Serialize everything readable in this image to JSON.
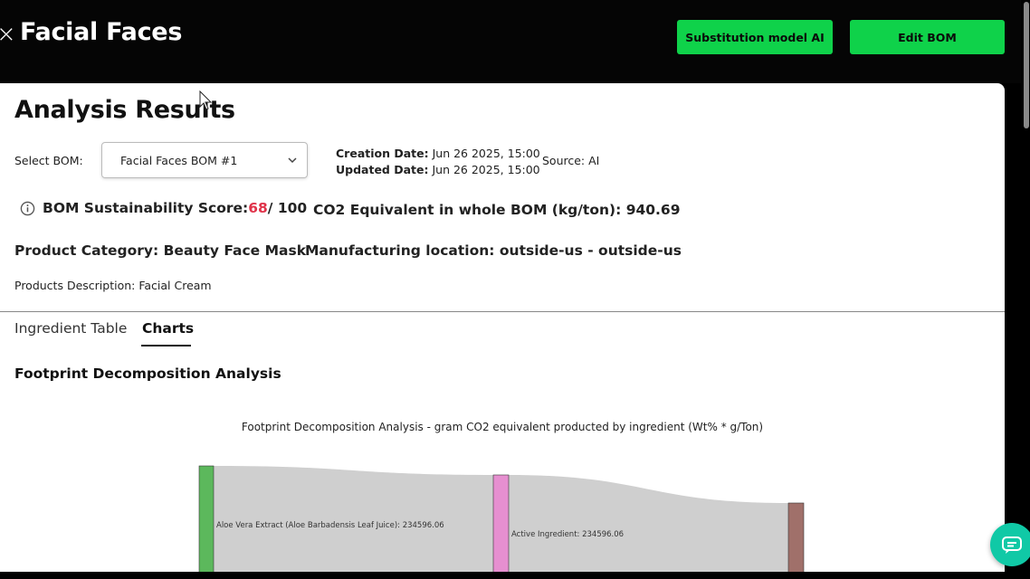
{
  "header": {
    "back_icon": "close-x-icon",
    "title": "Facial Faces",
    "buttons": {
      "substitution": "Substitution model AI",
      "edit_bom": "Edit BOM"
    },
    "accent_color": "#0fd24a"
  },
  "main": {
    "title": "Analysis Results",
    "select_label": "Select BOM:",
    "selected_bom": "Facial Faces BOM #1",
    "creation_label": "Creation Date:",
    "creation_value": " Jun 26 2025, 15:00",
    "updated_label": "Updated Date:",
    "updated_value": " Jun 26 2025, 15:00",
    "source": "Source: AI",
    "score_label": "BOM Sustainability Score: ",
    "score_value": "68",
    "score_max": " / 100",
    "score_color": "#e0334a",
    "co2": "CO2 Equivalent in whole BOM (kg/ton): 940.69",
    "category": "Product Category: Beauty Face Mask",
    "location": "Manufacturing location: outside-us - outside-us",
    "description": "Products Description: Facial Cream"
  },
  "tabs": [
    {
      "label": "Ingredient Table",
      "active": false
    },
    {
      "label": "Charts",
      "active": true
    }
  ],
  "section_title": "Footprint Decomposition Analysis",
  "chart_data": {
    "type": "sankey",
    "title": "Footprint Decomposition Analysis - gram CO2 equivalent producted by ingredient (Wt% * g/Ton)",
    "nodes": [
      {
        "label": "Aloe Vera Extract (Aloe Barbadensis Leaf Juice): 234596.06",
        "color": "#5cb85c"
      },
      {
        "label": "Active Ingredient: 234596.06",
        "color": "#e68fd0"
      },
      {
        "label": "",
        "color": "#a0706a"
      }
    ],
    "links": [
      {
        "source": 0,
        "target": 1,
        "value": 234596.06
      },
      {
        "source": 1,
        "target": 2,
        "value": 234596.06
      }
    ]
  }
}
